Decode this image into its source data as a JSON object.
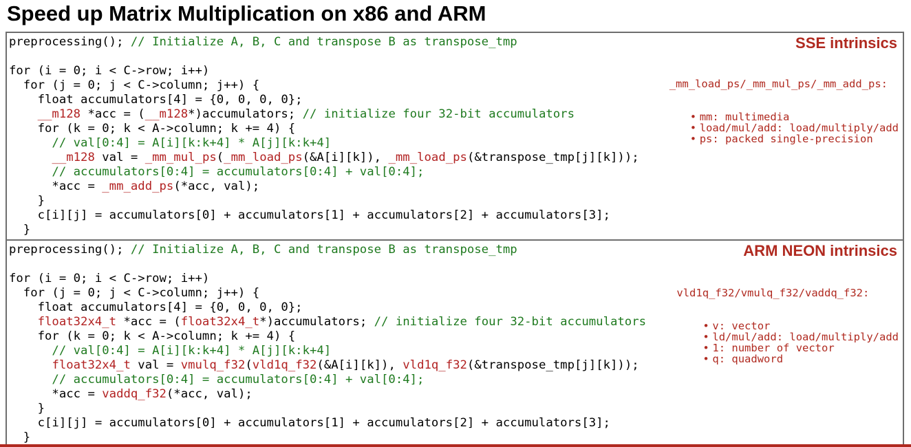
{
  "title": "Speed up Matrix Multiplication on x86 and ARM",
  "sse": {
    "heading": "SSE intrinsics",
    "note_head": "_mm_load_ps/_mm_mul_ps/_mm_add_ps:",
    "note_items": [
      "mm: multimedia",
      "load/mul/add: load/multiply/add",
      "ps: packed single-precision"
    ],
    "lines": [
      [
        {
          "t": "preprocessing(); ",
          "c": "kw"
        },
        {
          "t": "// Initialize A, B, C and transpose B as transpose_tmp",
          "c": "com"
        }
      ],
      [
        {
          "t": "",
          "c": "kw"
        }
      ],
      [
        {
          "t": "for (i = 0; i < C->row; i++)",
          "c": "kw"
        }
      ],
      [
        {
          "t": "  for (j = 0; j < C->column; j++) {",
          "c": "kw"
        }
      ],
      [
        {
          "t": "    float accumulators[4] = {0, 0, 0, 0};",
          "c": "kw"
        }
      ],
      [
        {
          "t": "    ",
          "c": "kw"
        },
        {
          "t": "__m128",
          "c": "intr"
        },
        {
          "t": " *acc = (",
          "c": "kw"
        },
        {
          "t": "__m128",
          "c": "intr"
        },
        {
          "t": "*)accumulators; ",
          "c": "kw"
        },
        {
          "t": "// initialize four 32-bit accumulators",
          "c": "com"
        }
      ],
      [
        {
          "t": "    for (k = 0; k < A->column; k += 4) {",
          "c": "kw"
        }
      ],
      [
        {
          "t": "      // val[0:4] = A[i][k:k+4] * A[j][k:k+4]",
          "c": "com"
        }
      ],
      [
        {
          "t": "      ",
          "c": "kw"
        },
        {
          "t": "__m128",
          "c": "intr"
        },
        {
          "t": " val = ",
          "c": "kw"
        },
        {
          "t": "_mm_mul_ps",
          "c": "intr"
        },
        {
          "t": "(",
          "c": "kw"
        },
        {
          "t": "_mm_load_ps",
          "c": "intr"
        },
        {
          "t": "(&A[i][k]), ",
          "c": "kw"
        },
        {
          "t": "_mm_load_ps",
          "c": "intr"
        },
        {
          "t": "(&transpose_tmp[j][k]));",
          "c": "kw"
        }
      ],
      [
        {
          "t": "      // accumulators[0:4] = accumulators[0:4] + val[0:4];",
          "c": "com"
        }
      ],
      [
        {
          "t": "      *acc = ",
          "c": "kw"
        },
        {
          "t": "_mm_add_ps",
          "c": "intr"
        },
        {
          "t": "(*acc, val);",
          "c": "kw"
        }
      ],
      [
        {
          "t": "    }",
          "c": "kw"
        }
      ],
      [
        {
          "t": "    c[i][j] = accumulators[0] + accumulators[1] + accumulators[2] + accumulators[3];",
          "c": "kw"
        }
      ],
      [
        {
          "t": "  }",
          "c": "kw"
        }
      ]
    ]
  },
  "neon": {
    "heading": "ARM NEON intrinsics",
    "note_head": "vld1q_f32/vmulq_f32/vaddq_f32:",
    "note_items": [
      "v: vector",
      "ld/mul/add: load/multiply/add",
      "1: number of vector",
      "q: quadword"
    ],
    "lines": [
      [
        {
          "t": "preprocessing(); ",
          "c": "kw"
        },
        {
          "t": "// Initialize A, B, C and transpose B as transpose_tmp",
          "c": "com"
        }
      ],
      [
        {
          "t": "",
          "c": "kw"
        }
      ],
      [
        {
          "t": "for (i = 0; i < C->row; i++)",
          "c": "kw"
        }
      ],
      [
        {
          "t": "  for (j = 0; j < C->column; j++) {",
          "c": "kw"
        }
      ],
      [
        {
          "t": "    float accumulators[4] = {0, 0, 0, 0};",
          "c": "kw"
        }
      ],
      [
        {
          "t": "    ",
          "c": "kw"
        },
        {
          "t": "float32x4_t",
          "c": "intr"
        },
        {
          "t": " *acc = (",
          "c": "kw"
        },
        {
          "t": "float32x4_t",
          "c": "intr"
        },
        {
          "t": "*)accumulators; ",
          "c": "kw"
        },
        {
          "t": "// initialize four 32-bit accumulators",
          "c": "com"
        }
      ],
      [
        {
          "t": "    for (k = 0; k < A->column; k += 4) {",
          "c": "kw"
        }
      ],
      [
        {
          "t": "      // val[0:4] = A[i][k:k+4] * A[j][k:k+4]",
          "c": "com"
        }
      ],
      [
        {
          "t": "      ",
          "c": "kw"
        },
        {
          "t": "float32x4_t",
          "c": "intr"
        },
        {
          "t": " val = ",
          "c": "kw"
        },
        {
          "t": "vmulq_f32",
          "c": "intr"
        },
        {
          "t": "(",
          "c": "kw"
        },
        {
          "t": "vld1q_f32",
          "c": "intr"
        },
        {
          "t": "(&A[i][k]), ",
          "c": "kw"
        },
        {
          "t": "vld1q_f32",
          "c": "intr"
        },
        {
          "t": "(&transpose_tmp[j][k]));",
          "c": "kw"
        }
      ],
      [
        {
          "t": "      // accumulators[0:4] = accumulators[0:4] + val[0:4];",
          "c": "com"
        }
      ],
      [
        {
          "t": "      *acc = ",
          "c": "kw"
        },
        {
          "t": "vaddq_f32",
          "c": "intr"
        },
        {
          "t": "(*acc, val);",
          "c": "kw"
        }
      ],
      [
        {
          "t": "    }",
          "c": "kw"
        }
      ],
      [
        {
          "t": "    c[i][j] = accumulators[0] + accumulators[1] + accumulators[2] + accumulators[3];",
          "c": "kw"
        }
      ],
      [
        {
          "t": "  }",
          "c": "kw"
        }
      ]
    ]
  },
  "colors": {
    "accent": "#b02a20",
    "comment": "#1f7a1f",
    "intrinsic": "#b22222"
  }
}
